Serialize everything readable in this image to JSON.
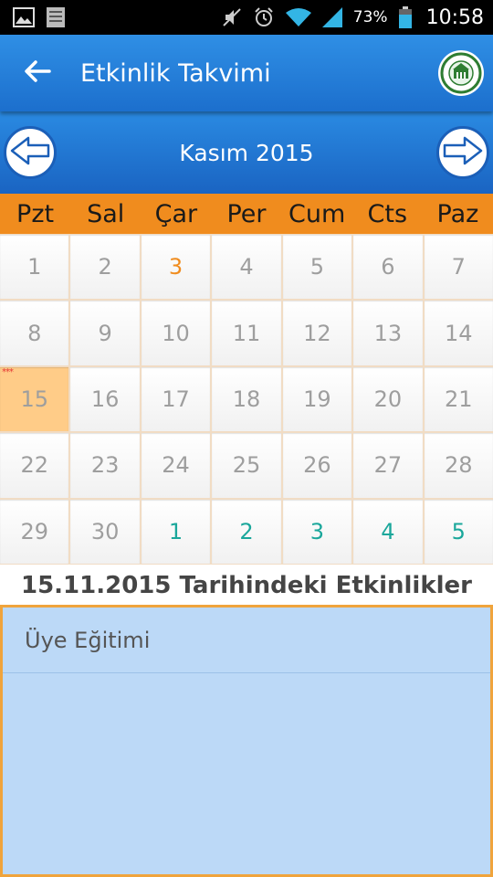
{
  "status_bar": {
    "battery": "73%",
    "time": "10:58",
    "icons": [
      "image-icon",
      "notes-icon",
      "mute-icon",
      "alarm-icon",
      "wifi-icon",
      "signal-icon",
      "battery-icon"
    ]
  },
  "app_bar": {
    "title": "Etkinlik Takvimi",
    "back_icon": "back-arrow-icon",
    "logo_icon": "chamber-logo-icon"
  },
  "calendar": {
    "month_title": "Kasım 2015",
    "prev_icon": "left-arrow-icon",
    "next_icon": "right-arrow-icon",
    "weekdays": [
      "Pzt",
      "Sal",
      "Çar",
      "Per",
      "Cum",
      "Cts",
      "Paz"
    ],
    "days": [
      {
        "label": "1",
        "state": "normal"
      },
      {
        "label": "2",
        "state": "normal"
      },
      {
        "label": "3",
        "state": "highlight"
      },
      {
        "label": "4",
        "state": "normal"
      },
      {
        "label": "5",
        "state": "normal"
      },
      {
        "label": "6",
        "state": "normal"
      },
      {
        "label": "7",
        "state": "normal"
      },
      {
        "label": "8",
        "state": "normal"
      },
      {
        "label": "9",
        "state": "normal"
      },
      {
        "label": "10",
        "state": "normal"
      },
      {
        "label": "11",
        "state": "normal"
      },
      {
        "label": "12",
        "state": "normal"
      },
      {
        "label": "13",
        "state": "normal"
      },
      {
        "label": "14",
        "state": "normal"
      },
      {
        "label": "15",
        "state": "selected",
        "event_marker": "***"
      },
      {
        "label": "16",
        "state": "normal"
      },
      {
        "label": "17",
        "state": "normal"
      },
      {
        "label": "18",
        "state": "normal"
      },
      {
        "label": "19",
        "state": "normal"
      },
      {
        "label": "20",
        "state": "normal"
      },
      {
        "label": "21",
        "state": "normal"
      },
      {
        "label": "22",
        "state": "normal"
      },
      {
        "label": "23",
        "state": "normal"
      },
      {
        "label": "24",
        "state": "normal"
      },
      {
        "label": "25",
        "state": "normal"
      },
      {
        "label": "26",
        "state": "normal"
      },
      {
        "label": "27",
        "state": "normal"
      },
      {
        "label": "28",
        "state": "normal"
      },
      {
        "label": "29",
        "state": "normal"
      },
      {
        "label": "30",
        "state": "normal"
      },
      {
        "label": "1",
        "state": "next-month"
      },
      {
        "label": "2",
        "state": "next-month"
      },
      {
        "label": "3",
        "state": "next-month"
      },
      {
        "label": "4",
        "state": "next-month"
      },
      {
        "label": "5",
        "state": "next-month"
      }
    ]
  },
  "events": {
    "header": "15.11.2015 Tarihindeki Etkinlikler",
    "items": [
      "Üye Eğitimi"
    ]
  },
  "colors": {
    "app_bar": "#1c6fcd",
    "weekday_bar": "#f08c1e",
    "selected_day": "#ffcc88",
    "highlight_day": "#f08c1e",
    "next_month_day": "#1aa79b",
    "events_bg": "#bcd9f7",
    "events_border": "#f0a43c"
  }
}
